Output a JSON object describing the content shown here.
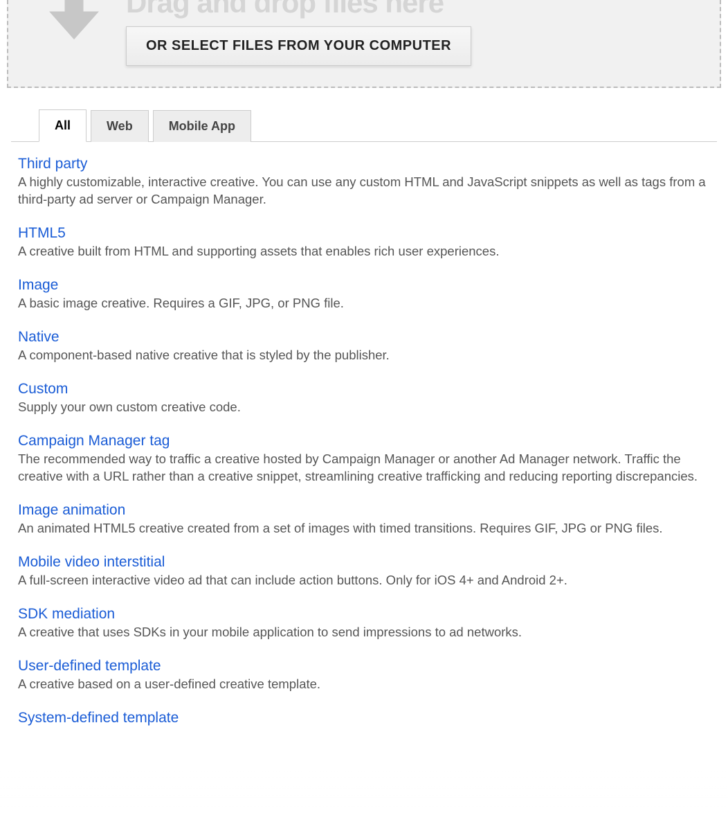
{
  "dropzone": {
    "heading": "Drag and drop files here",
    "button_label": "OR SELECT FILES FROM YOUR COMPUTER"
  },
  "tabs": [
    {
      "label": "All",
      "active": true
    },
    {
      "label": "Web",
      "active": false
    },
    {
      "label": "Mobile App",
      "active": false
    }
  ],
  "creatives": [
    {
      "title": "Third party",
      "desc": "A highly customizable, interactive creative. You can use any custom HTML and JavaScript snippets as well as tags from a third-party ad server or Campaign Manager."
    },
    {
      "title": "HTML5",
      "desc": "A creative built from HTML and supporting assets that enables rich user experiences."
    },
    {
      "title": "Image",
      "desc": "A basic image creative. Requires a GIF, JPG, or PNG file."
    },
    {
      "title": "Native",
      "desc": "A component-based native creative that is styled by the publisher."
    },
    {
      "title": "Custom",
      "desc": "Supply your own custom creative code."
    },
    {
      "title": "Campaign Manager tag",
      "desc": "The recommended way to traffic a creative hosted by Campaign Manager or another Ad Manager network. Traffic the creative with a URL rather than a creative snippet, streamlining creative trafficking and reducing reporting discrepancies."
    },
    {
      "title": "Image animation",
      "desc": "An animated HTML5 creative created from a set of images with timed transitions. Requires GIF, JPG or PNG files."
    },
    {
      "title": "Mobile video interstitial",
      "desc": "A full-screen interactive video ad that can include action buttons. Only for iOS 4+ and Android 2+."
    },
    {
      "title": "SDK mediation",
      "desc": "A creative that uses SDKs in your mobile application to send impressions to ad networks."
    },
    {
      "title": "User-defined template",
      "desc": "A creative based on a user-defined creative template."
    },
    {
      "title": "System-defined template",
      "desc": ""
    }
  ]
}
